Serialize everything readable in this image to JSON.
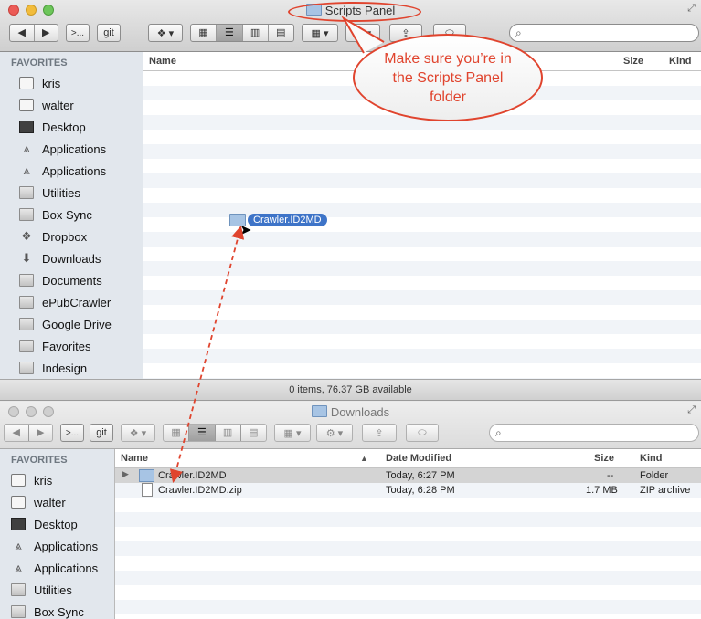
{
  "top_window": {
    "title": "Scripts Panel",
    "toolbar": {
      "git_label": "git",
      "terminal_label": ">..."
    },
    "sidebar": {
      "heading": "FAVORITES",
      "items": [
        {
          "label": "kris",
          "icon": "house-icon"
        },
        {
          "label": "walter",
          "icon": "disk-icon"
        },
        {
          "label": "Desktop",
          "icon": "desktop-icon"
        },
        {
          "label": "Applications",
          "icon": "applications-icon"
        },
        {
          "label": "Applications",
          "icon": "applications-icon"
        },
        {
          "label": "Utilities",
          "icon": "folder-icon"
        },
        {
          "label": "Box Sync",
          "icon": "folder-icon"
        },
        {
          "label": "Dropbox",
          "icon": "dropbox-icon"
        },
        {
          "label": "Downloads",
          "icon": "downloads-icon"
        },
        {
          "label": "Documents",
          "icon": "folder-icon"
        },
        {
          "label": "ePubCrawler",
          "icon": "folder-icon"
        },
        {
          "label": "Google Drive",
          "icon": "folder-icon"
        },
        {
          "label": "Favorites",
          "icon": "folder-icon"
        },
        {
          "label": "Indesign",
          "icon": "folder-icon"
        }
      ]
    },
    "columns": {
      "name": "Name",
      "size": "Size",
      "kind": "Kind"
    },
    "dragged_item": "Crawler.ID2MD",
    "status": "0 items, 76.37 GB available"
  },
  "callout": {
    "text": "Make sure you’re in the Scripts Panel folder",
    "color": "#e0442e"
  },
  "bottom_window": {
    "title": "Downloads",
    "toolbar": {
      "git_label": "git",
      "terminal_label": ">..."
    },
    "sidebar": {
      "heading": "FAVORITES",
      "items": [
        {
          "label": "kris",
          "icon": "house-icon"
        },
        {
          "label": "walter",
          "icon": "disk-icon"
        },
        {
          "label": "Desktop",
          "icon": "desktop-icon"
        },
        {
          "label": "Applications",
          "icon": "applications-icon"
        },
        {
          "label": "Applications",
          "icon": "applications-icon"
        },
        {
          "label": "Utilities",
          "icon": "folder-icon"
        },
        {
          "label": "Box Sync",
          "icon": "folder-icon"
        }
      ]
    },
    "columns": {
      "name": "Name",
      "date": "Date Modified",
      "size": "Size",
      "kind": "Kind"
    },
    "rows": [
      {
        "name": "Crawler.ID2MD",
        "date": "Today, 6:27 PM",
        "size": "--",
        "kind": "Folder",
        "selected": true
      },
      {
        "name": "Crawler.ID2MD.zip",
        "date": "Today, 6:28 PM",
        "size": "1.7 MB",
        "kind": "ZIP archive",
        "selected": false
      }
    ]
  }
}
